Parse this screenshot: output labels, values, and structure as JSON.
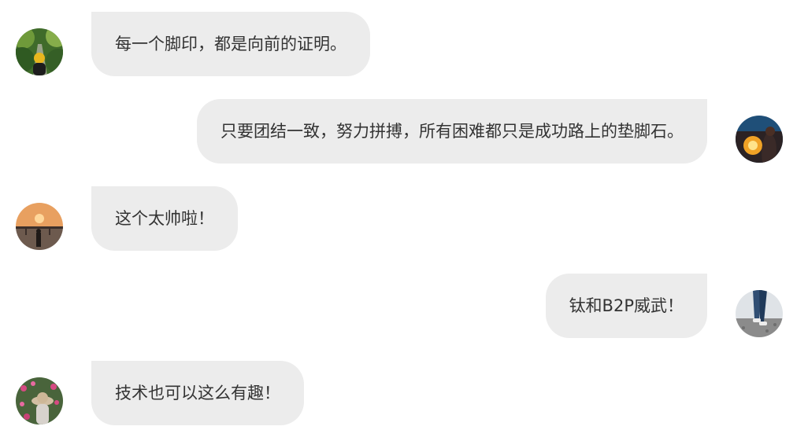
{
  "messages": [
    {
      "side": "left",
      "avatar": "avatar-forest-path",
      "text": "每一个脚印，都是向前的证明。"
    },
    {
      "side": "right",
      "avatar": "avatar-fire-night",
      "text": "只要团结一致，努力拼搏，所有困难都只是成功路上的垫脚石。"
    },
    {
      "side": "left",
      "avatar": "avatar-sunset-bridge",
      "text": "这个太帅啦！"
    },
    {
      "side": "right",
      "avatar": "avatar-walking-legs",
      "text": "钛和B2P威武！"
    },
    {
      "side": "left",
      "avatar": "avatar-flowers-hat",
      "text": "技术也可以这么有趣！"
    }
  ],
  "colors": {
    "bubble_bg": "#ececec",
    "text": "#333333",
    "page_bg": "#ffffff"
  }
}
